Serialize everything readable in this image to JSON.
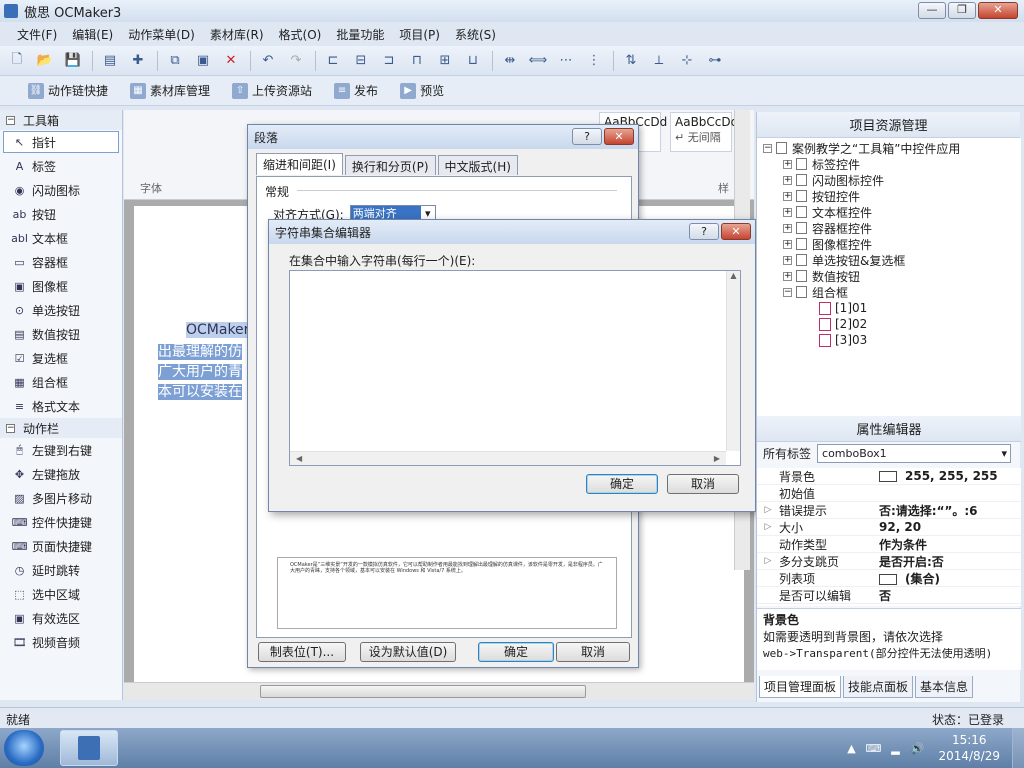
{
  "window": {
    "title": "傲思 OCMaker3",
    "controls": [
      "—",
      "❐",
      "✕"
    ]
  },
  "menubar": [
    "文件(F)",
    "编辑(E)",
    "动作菜单(D)",
    "素材库(R)",
    "格式(O)",
    "批量功能",
    "项目(P)",
    "系统(S)"
  ],
  "toolbar2": [
    {
      "label": "动作链快捷",
      "icon": "chain-icon"
    },
    {
      "label": "素材库管理",
      "icon": "library-icon"
    },
    {
      "label": "上传资源站",
      "icon": "upload-icon"
    },
    {
      "label": "发布",
      "icon": "publish-icon"
    },
    {
      "label": "预览",
      "icon": "preview-icon"
    }
  ],
  "toolbox": {
    "header1": "工具箱",
    "items1": [
      "指针",
      "标签",
      "闪动图标",
      "按钮",
      "文本框",
      "容器框",
      "图像框",
      "单选按钮",
      "数值按钮",
      "复选框",
      "组合框",
      "格式文本"
    ],
    "icons1": [
      "↖",
      "A",
      "◉",
      "ab",
      "abl",
      "▭",
      "▣",
      "⊙",
      "▤",
      "☑",
      "▦",
      "≡"
    ],
    "header2": "动作栏",
    "items2": [
      "左键到右键",
      "左键拖放",
      "多图片移动",
      "控件快捷键",
      "页面快捷键",
      "延时跳转",
      "选中区域",
      "有效选区",
      "视频音频"
    ]
  },
  "editor": {
    "style1": "AaBbCcDd",
    "style2": "AaBbCcDd",
    "style1sub": "文",
    "style2sub": "↵ 无间隔",
    "group_font": "字体",
    "group_style": "样",
    "doc_lines": [
      "OCMaker",
      "出最理解的仿",
      "广大用户的青",
      "本可以安装在"
    ]
  },
  "dlgPara": {
    "title": "段落",
    "tabs": [
      "缩进和间距(I)",
      "换行和分页(P)",
      "中文版式(H)"
    ],
    "section": "常规",
    "align_label": "对齐方式(G):",
    "align_value": "两端对齐",
    "preview_text": "OCMaker是“三维实景”开发的一款模拟仿真软件，它可以帮助制作者用最能找到理解出最理解的仿真课件，该软件是零开发，是非程序员。广大用户的青睐，支持各个领域，基本可以安装在 Windows 和 Vista/7 系统上。",
    "buttons": [
      "制表位(T)...",
      "设为默认值(D)",
      "确定",
      "取消"
    ]
  },
  "dlgStr": {
    "title": "字符串集合编辑器",
    "label": "在集合中输入字符串(每行一个)(E):",
    "ok": "确定",
    "cancel": "取消"
  },
  "project": {
    "title": "项目资源管理",
    "root": "案例教学之“工具箱”中控件应用",
    "nodes": [
      "标签控件",
      "闪动图标控件",
      "按钮控件",
      "文本框控件",
      "容器框控件",
      "图像框控件",
      "单选按钮&复选框",
      "数值按钮",
      "组合框"
    ],
    "children": [
      "[1]01",
      "[2]02",
      "[3]03"
    ]
  },
  "properties": {
    "title": "属性编辑器",
    "filter_label": "所有标签",
    "filter_value": "comboBox1",
    "rows": [
      {
        "name": "背景色",
        "value": "255, 255, 255",
        "swatch": true,
        "exp": ""
      },
      {
        "name": "初始值",
        "value": "",
        "exp": ""
      },
      {
        "name": "错误提示",
        "value": "否:请选择:“”。:6",
        "exp": "▷"
      },
      {
        "name": "大小",
        "value": "92, 20",
        "exp": "▷"
      },
      {
        "name": "动作类型",
        "value": "作为条件",
        "exp": ""
      },
      {
        "name": "多分支跳页",
        "value": "是否开启:否",
        "exp": "▷"
      },
      {
        "name": "列表项",
        "value": "(集合)",
        "swatch": true,
        "exp": ""
      },
      {
        "name": "是否可以编辑",
        "value": "否",
        "exp": ""
      }
    ],
    "desc_title": "背景色",
    "desc_text1": "如需要透明到背景图，请依次选择",
    "desc_text2": "web->Transparent(部分控件无法使用透明)"
  },
  "righttabs": [
    "项目管理面板",
    "技能点面板",
    "基本信息"
  ],
  "status": {
    "left": "就绪",
    "right": "状态：已登录"
  },
  "taskbar": {
    "time": "15:16",
    "date": "2014/8/29"
  }
}
